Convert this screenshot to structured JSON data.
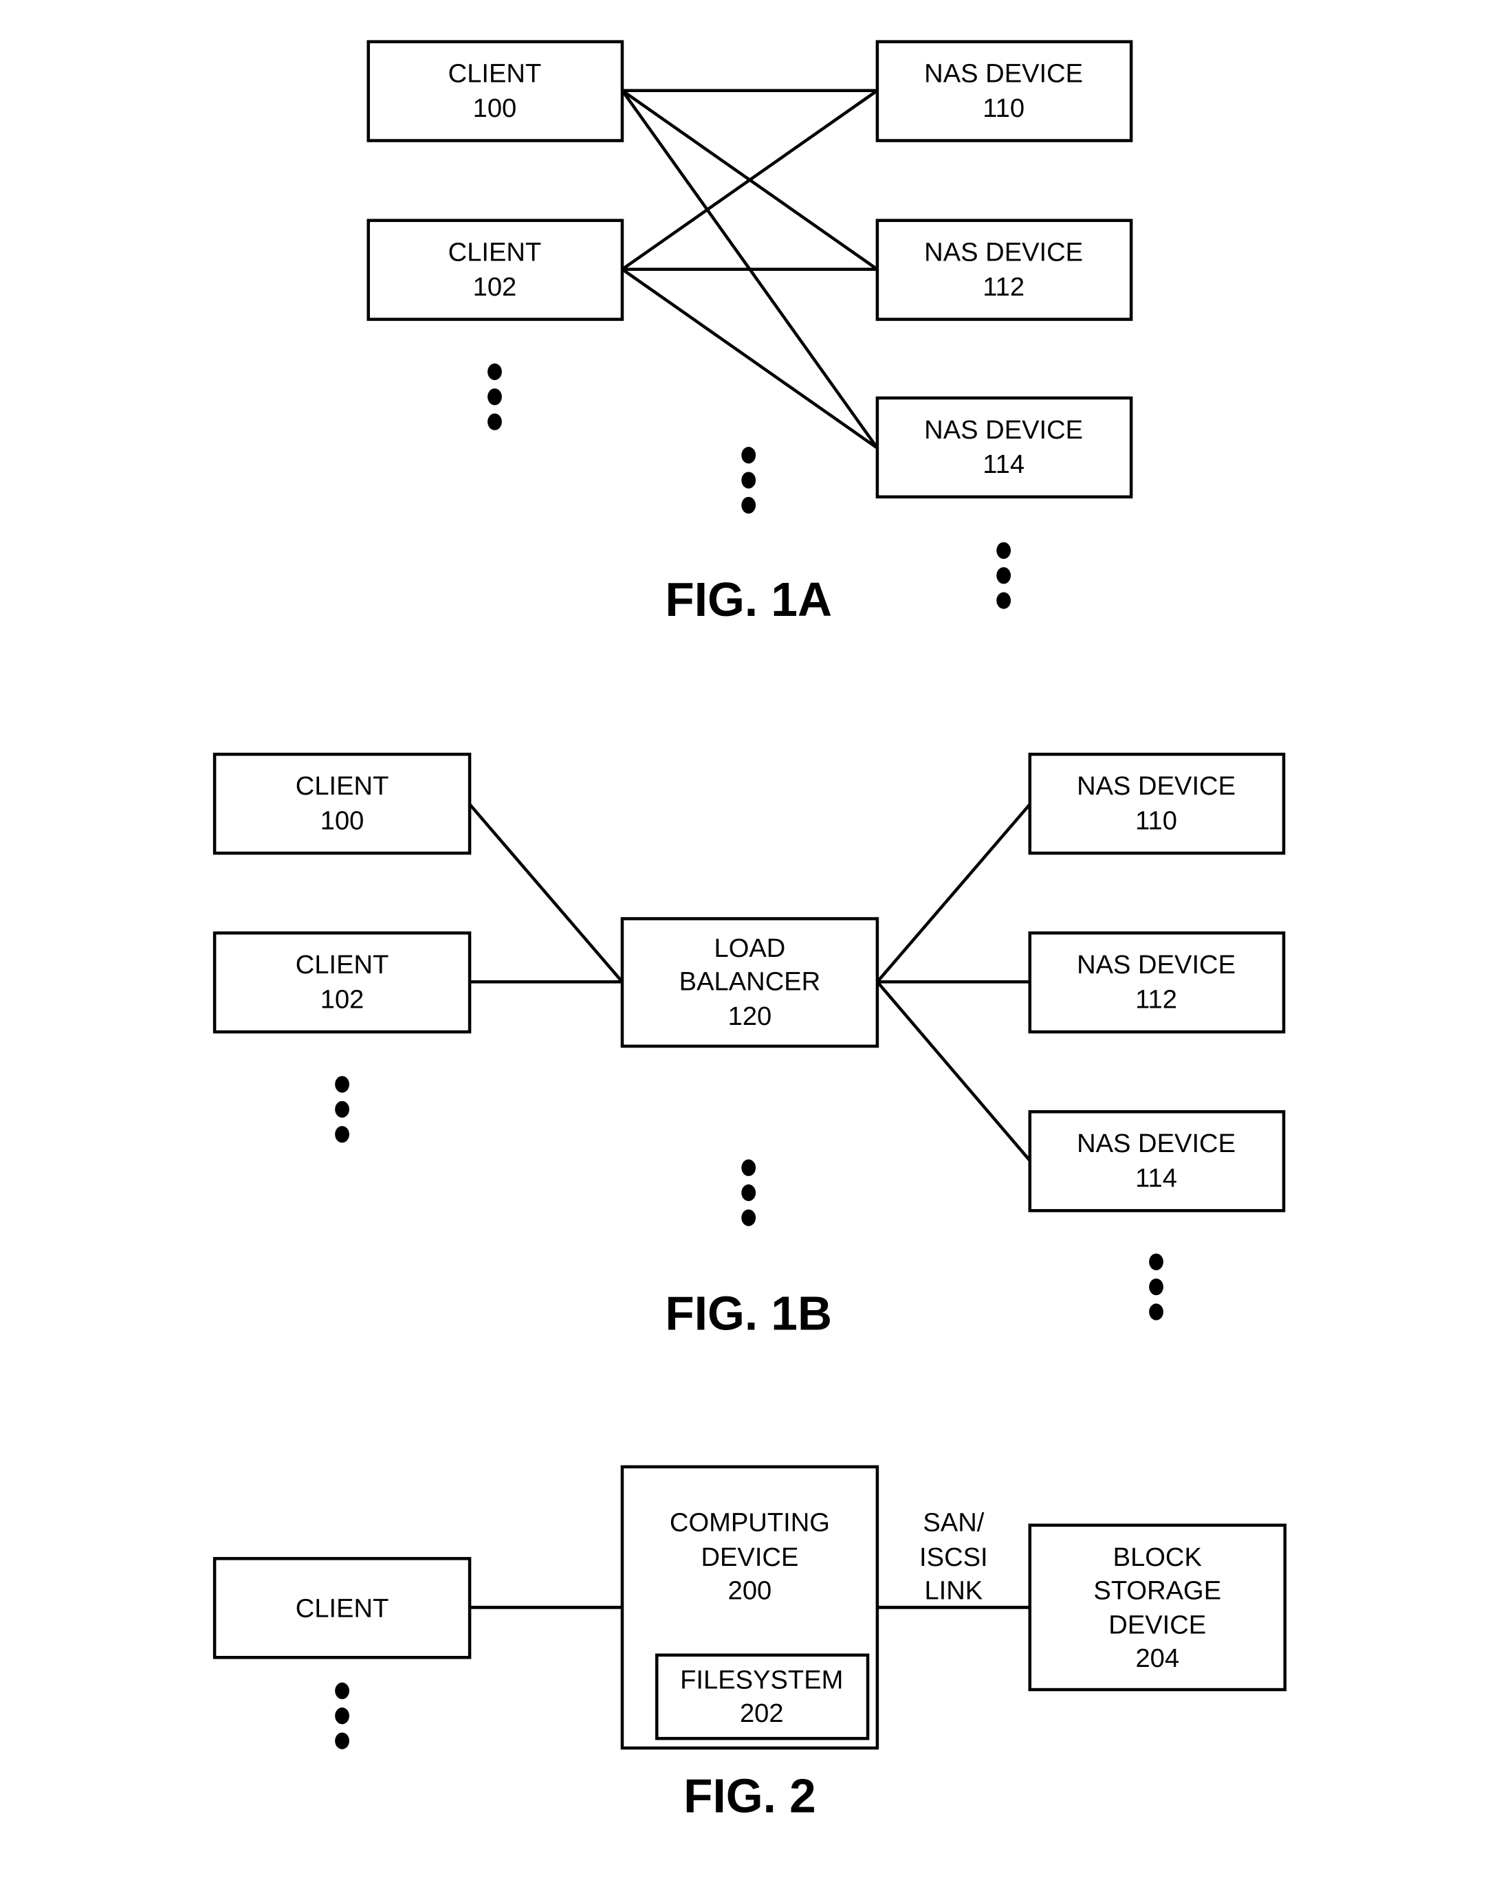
{
  "fig1a": {
    "caption": "FIG. 1A",
    "clients": [
      {
        "line1": "CLIENT",
        "line2": "100"
      },
      {
        "line1": "CLIENT",
        "line2": "102"
      }
    ],
    "nas": [
      {
        "line1": "NAS DEVICE",
        "line2": "110"
      },
      {
        "line1": "NAS DEVICE",
        "line2": "112"
      },
      {
        "line1": "NAS DEVICE",
        "line2": "114"
      }
    ]
  },
  "fig1b": {
    "caption": "FIG. 1B",
    "clients": [
      {
        "line1": "CLIENT",
        "line2": "100"
      },
      {
        "line1": "CLIENT",
        "line2": "102"
      }
    ],
    "balancer": {
      "line1": "LOAD",
      "line2": "BALANCER",
      "line3": "120"
    },
    "nas": [
      {
        "line1": "NAS DEVICE",
        "line2": "110"
      },
      {
        "line1": "NAS DEVICE",
        "line2": "112"
      },
      {
        "line1": "NAS DEVICE",
        "line2": "114"
      }
    ]
  },
  "fig2": {
    "caption": "FIG. 2",
    "client": "CLIENT",
    "computing": {
      "line1": "COMPUTING",
      "line2": "DEVICE",
      "line3": "200"
    },
    "filesystem": {
      "line1": "FILESYSTEM",
      "line2": "202"
    },
    "link": {
      "line1": "SAN/",
      "line2": "ISCSI",
      "line3": "LINK"
    },
    "storage": {
      "line1": "BLOCK",
      "line2": "STORAGE",
      "line3": "DEVICE",
      "line4": "204"
    }
  }
}
